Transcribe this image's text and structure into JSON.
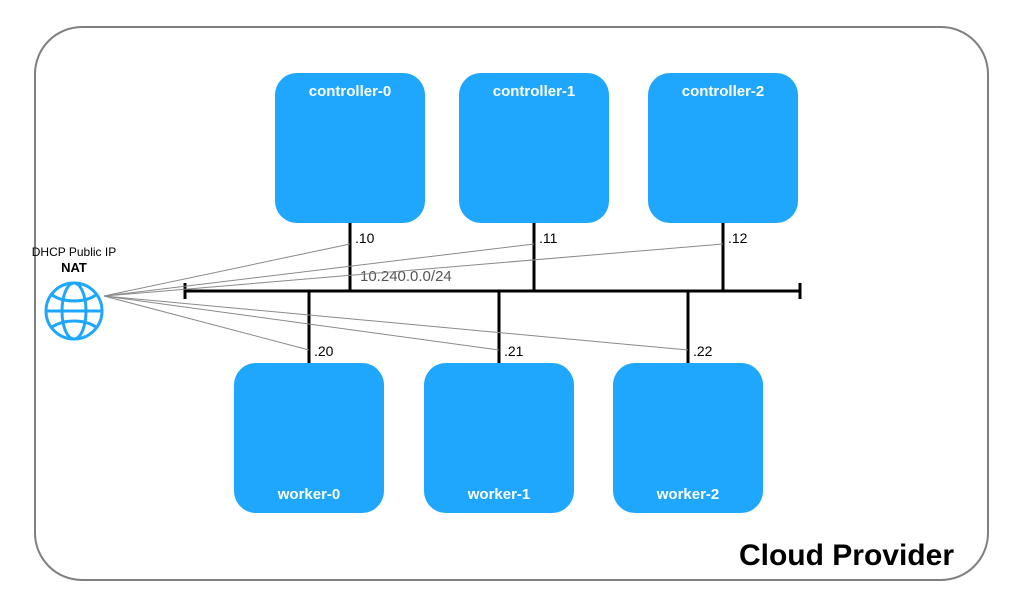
{
  "container": {
    "title": "Cloud Provider"
  },
  "internet": {
    "dhcp_label": "DHCP Public IP",
    "nat_label": "NAT"
  },
  "network": {
    "subnet": "10.240.0.0/24"
  },
  "nodes": {
    "controllers": [
      {
        "name": "controller-0",
        "ip_suffix": ".10"
      },
      {
        "name": "controller-1",
        "ip_suffix": ".11"
      },
      {
        "name": "controller-2",
        "ip_suffix": ".12"
      }
    ],
    "workers": [
      {
        "name": "worker-0",
        "ip_suffix": ".20"
      },
      {
        "name": "worker-1",
        "ip_suffix": ".21"
      },
      {
        "name": "worker-2",
        "ip_suffix": ".22"
      }
    ]
  },
  "colors": {
    "node_bg": "#1ea7fd",
    "globe": "#1ea7fd",
    "container_border": "#7f7f7f"
  }
}
